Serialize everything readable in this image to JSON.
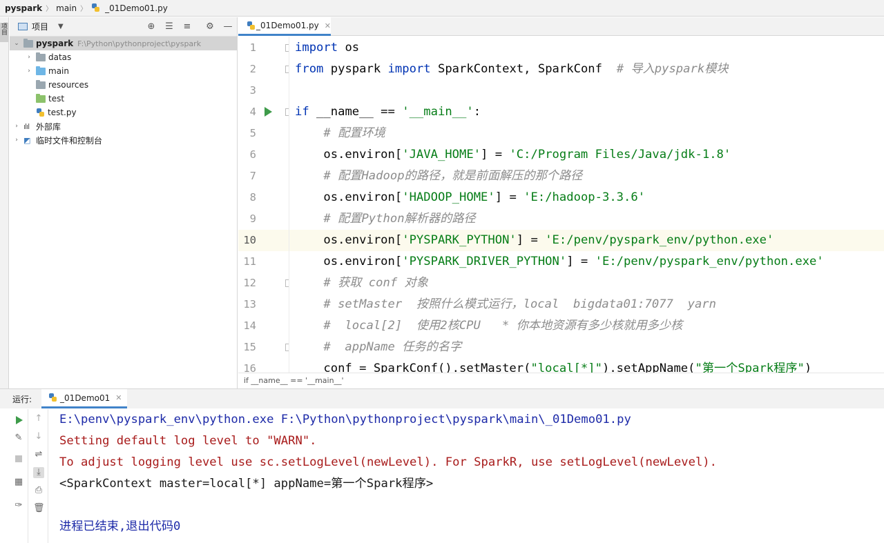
{
  "breadcrumb": {
    "project": "pyspark",
    "folder": "main",
    "file": "_01Demo01.py"
  },
  "left_strip": {
    "tab": "项目"
  },
  "project_panel": {
    "view_label": "项目",
    "root": {
      "name": "pyspark",
      "path": "F:\\Python\\pythonproject\\pyspark"
    },
    "items": [
      {
        "label": "datas"
      },
      {
        "label": "main"
      },
      {
        "label": "resources"
      },
      {
        "label": "test"
      },
      {
        "label": "test.py"
      },
      {
        "label": "外部库"
      },
      {
        "label": "临时文件和控制台"
      }
    ]
  },
  "editor": {
    "tab": "_01Demo01.py",
    "current_line": 10,
    "lines": [
      {
        "n": "1",
        "kw1": "import",
        "t1": " os"
      },
      {
        "n": "2",
        "kw1": "from",
        "t1": " pyspark ",
        "kw2": "import",
        "t2": " SparkContext, SparkConf  ",
        "cm": "# 导入pyspark模块"
      },
      {
        "n": "3"
      },
      {
        "n": "4",
        "kw1": "if",
        "t1": " __name__ == ",
        "s1": "'__main__'",
        "t2": ":"
      },
      {
        "n": "5",
        "cm": "    # 配置环境"
      },
      {
        "n": "6",
        "t1": "    os.environ[",
        "s1": "'JAVA_HOME'",
        "t2": "] = ",
        "s2": "'C:/Program Files/Java/jdk-1.8'"
      },
      {
        "n": "7",
        "cm": "    # 配置Hadoop的路径，就是前面解压的那个路径"
      },
      {
        "n": "8",
        "t1": "    os.environ[",
        "s1": "'HADOOP_HOME'",
        "t2": "] = ",
        "s2": "'E:/hadoop-3.3.6'"
      },
      {
        "n": "9",
        "cm": "    # 配置Python解析器的路径"
      },
      {
        "n": "10",
        "t1": "    os.environ[",
        "s1": "'PYSPARK_PYTHON'",
        "t2": "] = ",
        "s2": "'E:/penv/pyspark_env/python.exe'"
      },
      {
        "n": "11",
        "t1": "    os.environ[",
        "s1": "'PYSPARK_DRIVER_PYTHON'",
        "t2": "] = ",
        "s2": "'E:/penv/pyspark_env/python.exe'"
      },
      {
        "n": "12",
        "cm": "    # 获取 conf 对象"
      },
      {
        "n": "13",
        "cm": "    # setMaster  按照什么模式运行，local  bigdata01:7077  yarn"
      },
      {
        "n": "14",
        "cm": "    #  local[2]  使用2核CPU   * 你本地资源有多少核就用多少核"
      },
      {
        "n": "15",
        "cm": "    #  appName 任务的名字"
      },
      {
        "n": "16",
        "t1": "    conf = SparkConf().setMaster(",
        "s1": "\"local[*]\"",
        "t2": ").setAppName(",
        "s2": "\"第一个Spark程序\"",
        "t3": ")"
      }
    ],
    "context_breadcrumb": "if __name__ == '__main__'"
  },
  "run": {
    "label": "运行:",
    "tab": "_01Demo01",
    "console": [
      {
        "text": "E:\\penv\\pyspark_env\\python.exe F:\\Python\\pythonproject\\pyspark\\main\\_01Demo01.py",
        "kind": "path"
      },
      {
        "text": "Setting default log level to \"WARN\".",
        "kind": "err"
      },
      {
        "text": "To adjust logging level use sc.setLogLevel(newLevel). For SparkR, use setLogLevel(newLevel).",
        "kind": "err"
      },
      {
        "text": "<SparkContext master=local[*] appName=第一个Spark程序>",
        "kind": "out"
      },
      {
        "text": "",
        "kind": "out"
      },
      {
        "text": "进程已结束,退出代码0",
        "kind": "exit"
      }
    ]
  },
  "colors": {
    "keyword": "#0033b3",
    "string": "#067d17",
    "comment": "#8c8c8c",
    "stderr": "#a81b1b",
    "accent": "#4083c9",
    "run_green": "#3e9b4a"
  },
  "icons": [
    "folder-icon",
    "python-file-icon",
    "run-icon",
    "locate-icon",
    "expand-all-icon",
    "collapse-all-icon",
    "gear-icon",
    "hide-icon",
    "wrench-icon",
    "stop-icon",
    "soft-wrap-icon",
    "scroll-to-end-icon",
    "print-icon",
    "trash-icon",
    "pin-icon",
    "layout-icon",
    "arrow-up-icon",
    "arrow-down-icon"
  ]
}
